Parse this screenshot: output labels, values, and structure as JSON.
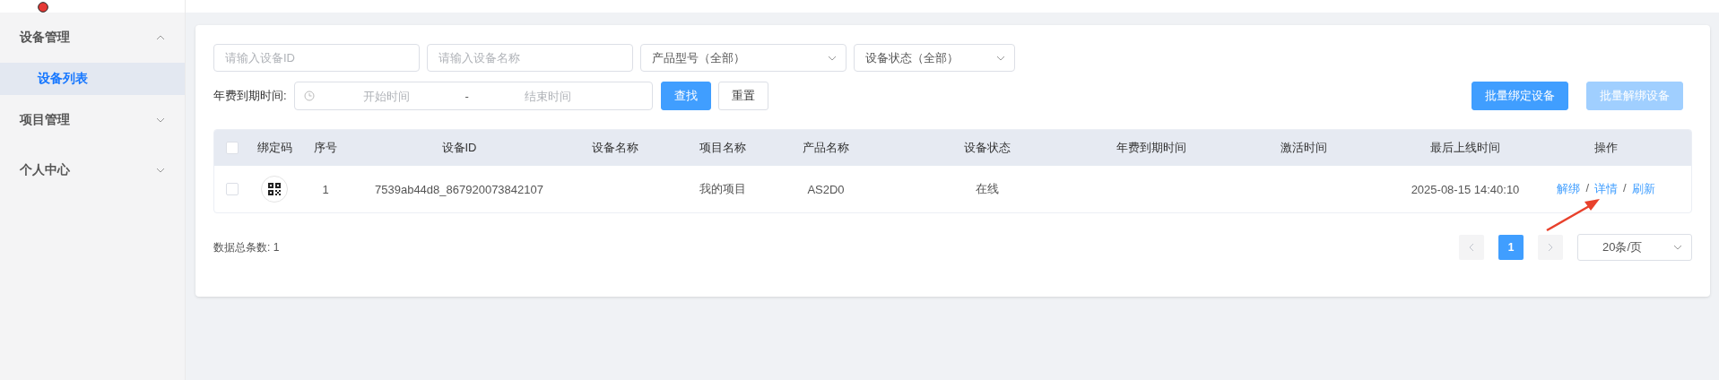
{
  "sidebar": {
    "items": [
      {
        "label": "设备管理",
        "expanded": true,
        "children": [
          {
            "label": "设备列表",
            "selected": true
          }
        ]
      },
      {
        "label": "项目管理",
        "expanded": false
      },
      {
        "label": "个人中心",
        "expanded": false
      }
    ]
  },
  "filters": {
    "device_id": {
      "placeholder": "请输入设备ID"
    },
    "device_name": {
      "placeholder": "请输入设备名称"
    },
    "product_model": {
      "value": "产品型号（全部）"
    },
    "device_status": {
      "value": "设备状态（全部）"
    },
    "date_label": "年费到期时间:",
    "start": {
      "placeholder": "开始时间"
    },
    "separator": "-",
    "end": {
      "placeholder": "结束时间"
    },
    "buttons": [
      {
        "label": "查找",
        "kind": "primary"
      },
      {
        "label": "重置",
        "kind": "default"
      }
    ]
  },
  "batch_buttons": [
    {
      "label": "批量绑定设备",
      "disabled": false
    },
    {
      "label": "批量解绑设备",
      "disabled": true
    }
  ],
  "table": {
    "header_checked": false,
    "columns": [
      "绑定码",
      "序号",
      "设备ID",
      "设备名称",
      "项目名称",
      "产品名称",
      "设备状态",
      "年费到期时间",
      "激活时间",
      "最后上线时间",
      "操作"
    ],
    "rows": [
      {
        "checked": false,
        "index": "1",
        "device_id": "7539ab44d8_867920073842107",
        "project": "我的项目",
        "product": "AS2D0",
        "status": "在线",
        "last_online": "2025-08-15 14:40:10",
        "actions": [
          "解绑",
          "详情",
          "刷新"
        ],
        "action_separator": "/"
      }
    ]
  },
  "total": "数据总条数: 1",
  "pagination": {
    "prev_disabled": true,
    "next_disabled": true,
    "pages": [
      {
        "label": "1",
        "selected": true
      }
    ],
    "page_size": "20条/页"
  }
}
